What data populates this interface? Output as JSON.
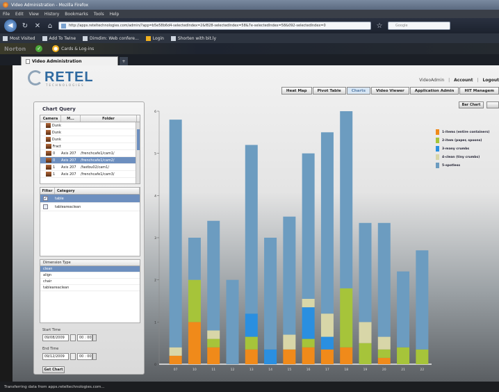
{
  "browser": {
    "title": "Video Administration - Mozilla Firefox",
    "menu": [
      "File",
      "Edit",
      "View",
      "History",
      "Bookmarks",
      "Tools",
      "Help"
    ],
    "url": "http://apps.reteltechnologies.com/admin/?app=b5e58b6d4-selectedIndex=2&f828-selectedIndex=58&7e-selectedIndex=58&092-selectedIndex=0",
    "search_placeholder": "Google",
    "bookmarks": [
      "Most Visited",
      "Add To Twine",
      "Dimdim: Web confere...",
      "Login",
      "Shorten with bit.ly"
    ],
    "norton": {
      "brand": "Norton",
      "cards": "Cards & Log-ins"
    },
    "tab_title": "Video Administration",
    "status": "Transferring data from apps.reteltechnologies.com..."
  },
  "app": {
    "logo": "RETEL",
    "logo_sub": "TECHNOLOGIES",
    "toplinks": {
      "user": "VideoAdmin",
      "account": "Account",
      "logout": "Logout"
    },
    "navtabs": [
      "Heat Map",
      "Pivot Table",
      "Charts",
      "Video Viewer",
      "Application Admin",
      "HIT Managem"
    ],
    "active_tab": "Charts"
  },
  "query": {
    "title": "Chart Query",
    "camera_headers": [
      "Camera",
      "M...",
      "Folder"
    ],
    "camera_rows": [
      {
        "name": "Dunk",
        "media": "",
        "folder": "",
        "selected": false
      },
      {
        "name": "Dunk",
        "media": "",
        "folder": "",
        "selected": false
      },
      {
        "name": "Dunk",
        "media": "",
        "folder": "",
        "selected": false
      },
      {
        "name": "Fract",
        "media": "",
        "folder": "",
        "selected": false
      },
      {
        "name": "0",
        "media": "Axis 207",
        "folder": "/frenchcafe1/cam1/",
        "selected": false
      },
      {
        "name": "0",
        "media": "Axis 207",
        "folder": "/frenchcafe1/cam2/",
        "selected": true
      },
      {
        "name": "1",
        "media": "Axis 207",
        "folder": "/fastbu02/cam1/",
        "selected": false
      },
      {
        "name": "1",
        "media": "Axis 207",
        "folder": "/frenchcafe1/cam3/",
        "selected": false
      }
    ],
    "filter_headers": [
      "Filter",
      "Category"
    ],
    "filter_rows": [
      {
        "label": "table",
        "checked": true,
        "selected": true
      },
      {
        "label": "tableareaclean",
        "checked": false,
        "selected": false
      }
    ],
    "dimension_header": "Dimension Type",
    "dimensions": [
      "clean",
      "align",
      "chair",
      "tableareaclean"
    ],
    "selected_dimension": "clean",
    "start_time_label": "Start Time",
    "start_date": "09/08/2009",
    "start_time": "00 : 00",
    "end_time_label": "End Time",
    "end_date": "09/12/2009",
    "end_time": "00 : 00",
    "get_chart": "Get Chart"
  },
  "chart_button": "Bar Chart",
  "chart_data": {
    "type": "bar",
    "stacked": true,
    "categories": [
      "07",
      "10",
      "11",
      "12",
      "13",
      "14",
      "15",
      "16",
      "17",
      "18",
      "19",
      "20",
      "21",
      "22"
    ],
    "ylim": [
      0,
      6
    ],
    "yticks": [
      "0",
      "1",
      "2",
      "3",
      "4",
      "5",
      "6"
    ],
    "series": [
      {
        "name": "1-items (entire containers)",
        "color": "#f08a1a",
        "values": [
          0.2,
          1.0,
          0.4,
          0,
          0.35,
          0,
          0.35,
          0.4,
          0.35,
          0.4,
          0,
          0.15,
          0,
          0
        ]
      },
      {
        "name": "2-item (paper, spoons)",
        "color": "#a6c43a",
        "values": [
          0,
          1.0,
          0.2,
          0,
          0.3,
          0,
          0,
          0.2,
          0,
          1.4,
          0.5,
          0.2,
          0.4,
          0.35
        ]
      },
      {
        "name": "3-many crumbs",
        "color": "#2a8fe0",
        "values": [
          0,
          0,
          0,
          0,
          0.55,
          0.35,
          0,
          0.75,
          0.3,
          0,
          0,
          0,
          0,
          0
        ]
      },
      {
        "name": "4-clean (tiny crumbs)",
        "color": "#d8d6a8",
        "values": [
          0.2,
          0,
          0.2,
          0,
          0,
          0,
          0.35,
          0.2,
          0.55,
          0,
          0.5,
          0.3,
          0,
          0
        ]
      },
      {
        "name": "5-spotless",
        "color": "#6c9cc0",
        "values": [
          5.4,
          1.0,
          2.6,
          2.0,
          4.0,
          2.65,
          2.8,
          3.45,
          4.3,
          4.2,
          2.35,
          2.7,
          1.8,
          2.35
        ]
      }
    ]
  }
}
